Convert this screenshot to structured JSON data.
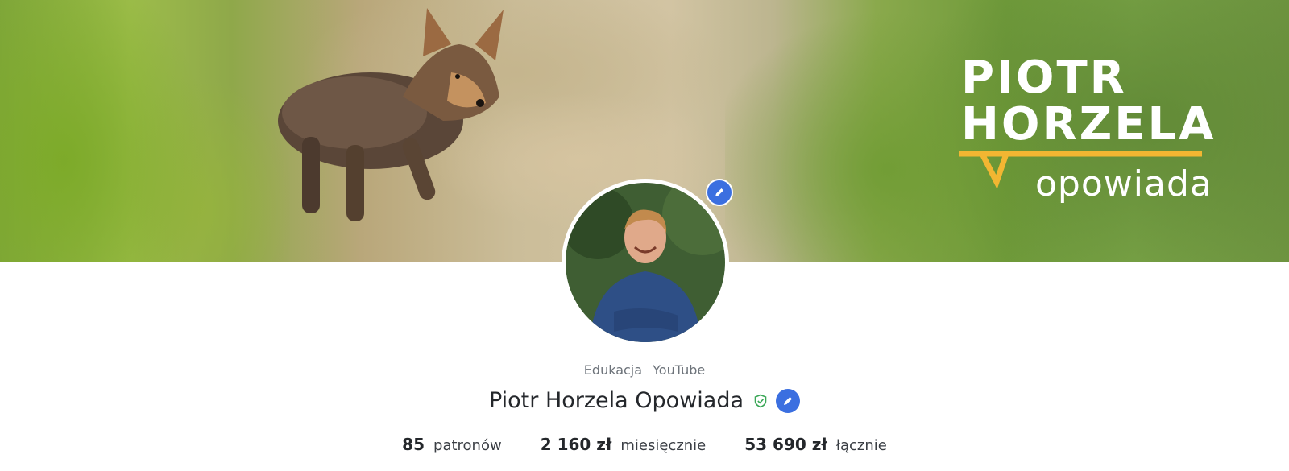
{
  "banner": {
    "logo": {
      "line1": "PIOTR",
      "line2": "HORZELA",
      "sub": "opowiada"
    }
  },
  "profile": {
    "categories": [
      "Edukacja",
      "YouTube"
    ],
    "name": "Piotr Horzela Opowiada"
  },
  "stats": [
    {
      "value": "85",
      "label": "patronów"
    },
    {
      "value": "2 160 zł",
      "label": "miesięcznie"
    },
    {
      "value": "53 690 zł",
      "label": "łącznie"
    }
  ],
  "icons": {
    "edit": "pencil-icon",
    "verified": "shield-check-icon"
  },
  "colors": {
    "accent": "#3b6fe0",
    "verified": "#3aa757",
    "logo_yellow": "#f2b632"
  }
}
